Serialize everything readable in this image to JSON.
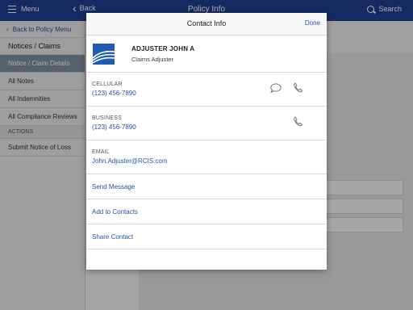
{
  "topbar": {
    "menu_label": "Menu",
    "back_label": "Back",
    "title": "Policy Info",
    "search_label": "Search"
  },
  "sidebar": {
    "back_label": "Back to Policy Menu",
    "heading": "Notices / Claims",
    "items": [
      {
        "label": "Notice / Claim Details"
      },
      {
        "label": "All Notes"
      },
      {
        "label": "All Indemnities"
      },
      {
        "label": "All Compliance Reviews"
      }
    ],
    "section_label": "ACTIONS",
    "action_items": [
      {
        "label": "Submit Notice of Loss"
      }
    ]
  },
  "modal": {
    "title": "Contact Info",
    "done_label": "Done",
    "contact_name": "ADJUSTER JOHN A",
    "contact_role": "Claims Adjuster",
    "fields": [
      {
        "label": "CELLULAR",
        "value": "(123) 456-7890",
        "icons": [
          "message-icon",
          "phone-icon"
        ]
      },
      {
        "label": "BUSINESS",
        "value": "(123) 456-7890",
        "icons": [
          "phone-icon"
        ]
      },
      {
        "label": "EMAIL",
        "value": "John.Adjuster@RCIS.com",
        "icons": []
      }
    ],
    "actions": [
      {
        "label": "Send Message"
      },
      {
        "label": "Add to Contacts"
      },
      {
        "label": "Share Contact"
      }
    ]
  },
  "colors": {
    "topbar": "#1f3f8f",
    "link": "#2355a8",
    "active_sidebar": "#7f8fa3",
    "logo_blue": "#1f5bb0"
  }
}
